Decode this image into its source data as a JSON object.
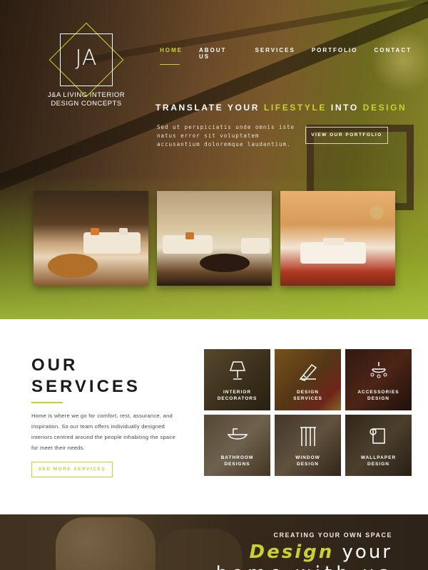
{
  "brand": {
    "mark": "JA",
    "name_line1": "J&A LIVING INTERIOR",
    "name_line2": "DESIGN CONCEPTS"
  },
  "nav": {
    "items": [
      {
        "label": "HOME",
        "active": true
      },
      {
        "label": "ABOUT US",
        "active": false
      },
      {
        "label": "SERVICES",
        "active": false
      },
      {
        "label": "PORTFOLIO",
        "active": false
      },
      {
        "label": "CONTACT",
        "active": false
      }
    ]
  },
  "hero": {
    "tagline_part1": "TRANSLATE YOUR ",
    "tagline_highlight1": "LIFESTYLE",
    "tagline_part2": " INTO ",
    "tagline_highlight2": "DESIGN",
    "description": "Sed ut perspiciatis unde omnis iste natus error sit voluptatem accusantium doloremque laudantium.",
    "portfolio_button": "VIEW OUR PORTFOLIO"
  },
  "services": {
    "title_line1": "OUR",
    "title_line2": "SERVICES",
    "description": "Home is where we go for comfort, rest, assurance, and inspiration. So our team offers individually designed interiors centred around the people inhabiting the space for meet their needs.",
    "more_button": "SEE MORE SERVICES",
    "tiles": [
      {
        "line1": "INTERIOR",
        "line2": "DECORATORS",
        "icon": "lamp-icon"
      },
      {
        "line1": "DESIGN",
        "line2": "SERVICES",
        "icon": "drafting-tools-icon"
      },
      {
        "line1": "ACCESSORIES",
        "line2": "DESIGN",
        "icon": "chandelier-icon"
      },
      {
        "line1": "BATHROOM",
        "line2": "DESIGNS",
        "icon": "bathtub-icon"
      },
      {
        "line1": "WINDOW",
        "line2": "DESIGN",
        "icon": "window-curtain-icon"
      },
      {
        "line1": "WALLPAPER",
        "line2": "DESIGN",
        "icon": "wallpaper-roll-icon"
      }
    ]
  },
  "banner": {
    "subtitle": "CREATING YOUR OWN SPACE",
    "headline_highlight": "Design",
    "headline_rest": " your",
    "headline_line2": "home with us"
  },
  "colors": {
    "accent": "#c9d12e",
    "dark_text": "#1b1b1b"
  }
}
